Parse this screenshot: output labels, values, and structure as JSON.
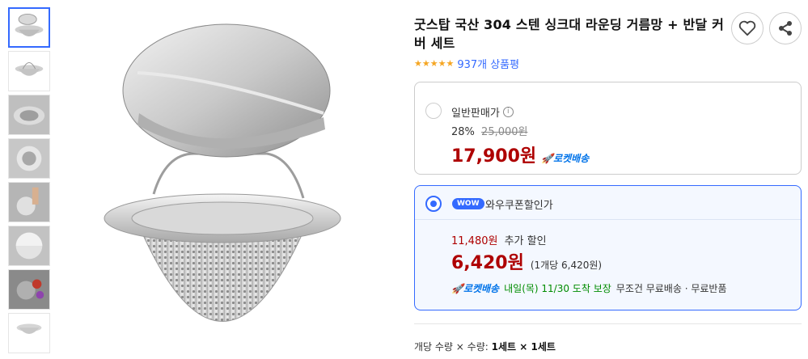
{
  "product": {
    "title": "굿스탑 국산 304 스텐 싱크대 라운딩 거름망 + 반달 커버 세트",
    "rating_stars": "★★★★★",
    "review_count": "937개 상품평"
  },
  "thumbnails": [
    {
      "name": "thumb-1",
      "active": true
    },
    {
      "name": "thumb-2",
      "active": false
    },
    {
      "name": "thumb-3",
      "active": false
    },
    {
      "name": "thumb-4",
      "active": false
    },
    {
      "name": "thumb-5",
      "active": false
    },
    {
      "name": "thumb-6",
      "active": false
    },
    {
      "name": "thumb-7",
      "active": false
    },
    {
      "name": "thumb-8",
      "active": false
    }
  ],
  "regular_price": {
    "label": "일반판매가",
    "info_icon": "i",
    "discount_rate": "28%",
    "original_price": "25,000원",
    "price": "17,900원",
    "delivery_badge": "🚀로켓배송"
  },
  "wow_price": {
    "badge": "WOW",
    "label": "와우쿠폰할인가",
    "extra_discount_amount": "11,480원",
    "extra_discount_label": "추가 할인",
    "price": "6,420원",
    "unit_price": "(1개당 6,420원)",
    "delivery_badge": "🚀로켓배송",
    "arrival": "내일(목) 11/30 도착 보장",
    "benefits": "무조건 무료배송 · 무료반품"
  },
  "quantity": {
    "prefix": "개당 수량 × 수량:",
    "value": "1세트 × 1세트"
  },
  "icons": {
    "wish": "heart-icon",
    "share": "share-icon"
  },
  "colors": {
    "accent": "#346aff",
    "price_red": "#ae0000",
    "rocket_blue": "#0073e9",
    "delivery_green": "#008c00",
    "star": "#f5a623"
  }
}
